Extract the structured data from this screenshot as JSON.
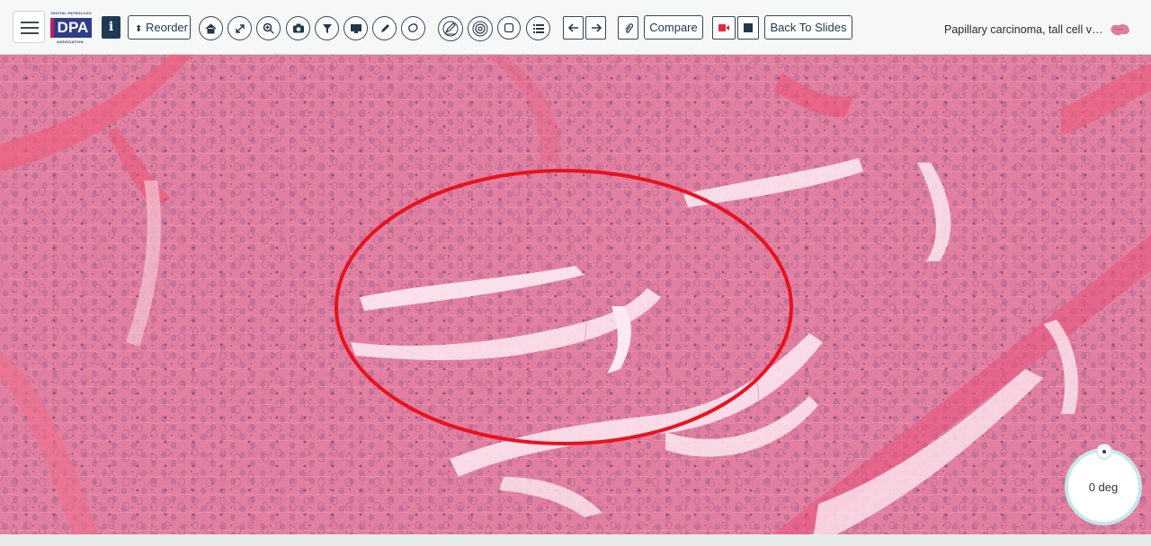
{
  "toolbar": {
    "logo": {
      "tagline": "DIGITAL PATHOLOGY",
      "text": "DPA",
      "sub": "ASSOCIATION"
    },
    "info_label": "i",
    "reorder_label": "Reorder",
    "compare_label": "Compare",
    "back_label": "Back To Slides",
    "tools": [
      "home-icon",
      "expand-icon",
      "zoom-in-icon",
      "camera-icon",
      "filter-icon",
      "monitor-icon",
      "pencil-icon",
      "lasso-icon",
      "draw-edit-icon",
      "target-icon",
      "square-icon",
      "list-icon"
    ],
    "nav": [
      "arrow-left-icon",
      "arrow-right-icon"
    ],
    "record_color": "#e02a3a"
  },
  "slide": {
    "title": "Papillary carcinoma, tall cell variant",
    "annotation_color": "#e8121e",
    "tissue_color": "#e07e9e"
  },
  "rotation": {
    "value": "0 deg"
  }
}
